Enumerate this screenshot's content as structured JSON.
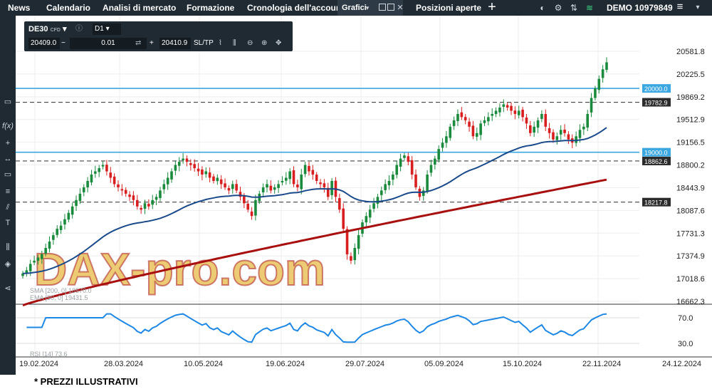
{
  "nav": {
    "items": [
      "News",
      "Calendario",
      "Analisi di mercato",
      "Formazione",
      "Cronologia dell'account",
      "Grafici",
      "Posizioni aperte"
    ],
    "active": "Grafici",
    "demo_label": "DEMO",
    "account_number": "10979849"
  },
  "toolbar": {
    "symbol": "DE30",
    "symbol_suffix": "CFD",
    "timeframe": "D1",
    "bid": "20409.0",
    "volume": "0.01",
    "ask": "20410.9",
    "sltp": "SL/TP"
  },
  "indicators": {
    "sma_label": "SMA [200, 0] 18570.0",
    "ema_label": "EMA [50, 0] 19431.5",
    "rsi_label": "RSI [14] 73.6"
  },
  "watermark": "DAX-pro.com",
  "footnote": "* PREZZI ILLUSTRATIVI",
  "colors": {
    "nav_bg": "#1f2a33",
    "bull": "#1a8a3c",
    "bear": "#d81e1e",
    "ema": "#1a4a8a",
    "sma": "#a80f0f",
    "level_line": "#3aa7e0",
    "rsi": "#1e88e5"
  },
  "chart_data": {
    "type": "candlestick",
    "price_axis_ticks": [
      "20581.8",
      "20225.5",
      "19869.2",
      "19512.9",
      "19156.5",
      "18800.2",
      "18443.9",
      "18087.6",
      "17731.3",
      "17374.9",
      "17018.6",
      "16662.3"
    ],
    "rsi_axis_ticks": [
      "70.0",
      "30.0"
    ],
    "x_axis_ticks": [
      "19.02.2024",
      "28.03.2024",
      "10.05.2024",
      "19.06.2024",
      "29.07.2024",
      "05.09.2024",
      "15.10.2024",
      "22.11.2024",
      "24.12.2024"
    ],
    "horizontal_levels": [
      {
        "value": 20000.0,
        "label": "20000.0",
        "style": "solid-blue"
      },
      {
        "value": 19782.9,
        "label": "19782.9",
        "style": "dashed"
      },
      {
        "value": 19000.0,
        "label": "19000.0",
        "style": "solid-blue"
      },
      {
        "value": 18862.6,
        "label": "18862.6",
        "style": "dashed"
      },
      {
        "value": 18217.8,
        "label": "18217.8",
        "style": "dashed"
      }
    ],
    "closes": [
      17100,
      17150,
      17250,
      17300,
      17350,
      17400,
      17500,
      17600,
      17700,
      17800,
      17850,
      17950,
      18050,
      18150,
      18250,
      18350,
      18450,
      18550,
      18650,
      18700,
      18750,
      18800,
      18700,
      18600,
      18500,
      18450,
      18400,
      18350,
      18300,
      18250,
      18150,
      18100,
      18200,
      18150,
      18250,
      18300,
      18400,
      18500,
      18600,
      18700,
      18800,
      18850,
      18900,
      18850,
      18800,
      18750,
      18700,
      18650,
      18700,
      18600,
      18550,
      18600,
      18500,
      18450,
      18400,
      18500,
      18400,
      18300,
      18200,
      18100,
      18000,
      18250,
      18350,
      18450,
      18500,
      18400,
      18450,
      18500,
      18550,
      18600,
      18700,
      18500,
      18450,
      18650,
      18800,
      18700,
      18650,
      18550,
      18500,
      18450,
      18300,
      18550,
      18300,
      18100,
      17800,
      17400,
      17300,
      17500,
      17700,
      17900,
      18000,
      18100,
      18200,
      18300,
      18400,
      18500,
      18550,
      18650,
      18800,
      18900,
      18950,
      18850,
      18650,
      18450,
      18300,
      18400,
      18650,
      18800,
      18900,
      19050,
      19150,
      19250,
      19400,
      19500,
      19600,
      19550,
      19500,
      19400,
      19250,
      19300,
      19450,
      19500,
      19550,
      19600,
      19650,
      19700,
      19750,
      19700,
      19650,
      19600,
      19650,
      19550,
      19450,
      19300,
      19400,
      19500,
      19600,
      19400,
      19300,
      19200,
      19250,
      19350,
      19300,
      19200,
      19150,
      19250,
      19350,
      19400,
      19600,
      19850,
      20000,
      20150,
      20300,
      20409
    ],
    "ema50_last": 19431.5,
    "sma200_last": 18570.0,
    "rsi_last": 73.6
  }
}
